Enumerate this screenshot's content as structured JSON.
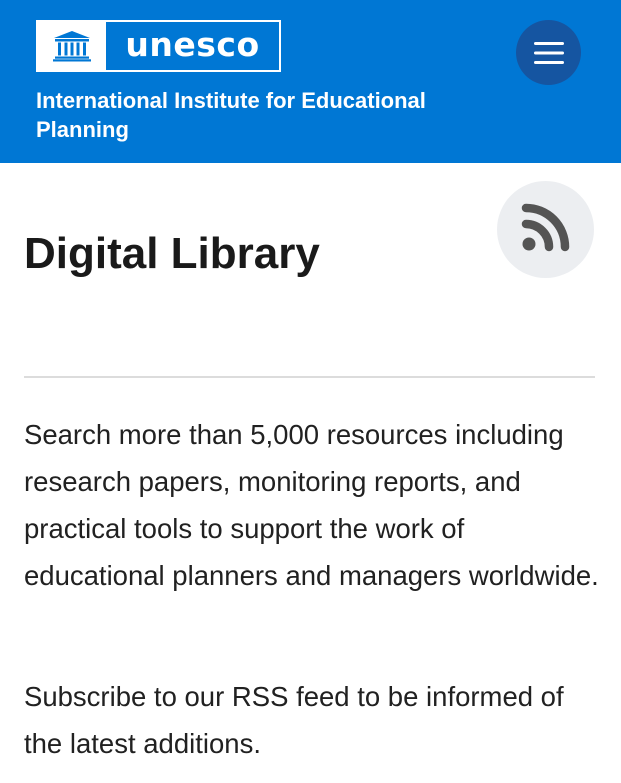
{
  "header": {
    "logo": {
      "wordmark": "unesco",
      "emblem_icon": "unesco-temple-icon"
    },
    "institute_name": "International Institute for Educational Planning",
    "menu_icon": "hamburger-menu-icon",
    "background_color": "#0077d4",
    "menu_button_color": "#1555a1"
  },
  "main": {
    "title": "Digital Library",
    "rss_icon": "rss-feed-icon",
    "rss_button_color": "#eceef1",
    "rss_icon_color": "#545454",
    "intro": "Search more than 5,000 resources including research papers, monitoring reports, and practical tools to support the work of educational planners and managers worldwide.",
    "subscribe": "Subscribe to our RSS feed to be informed of the latest additions."
  }
}
